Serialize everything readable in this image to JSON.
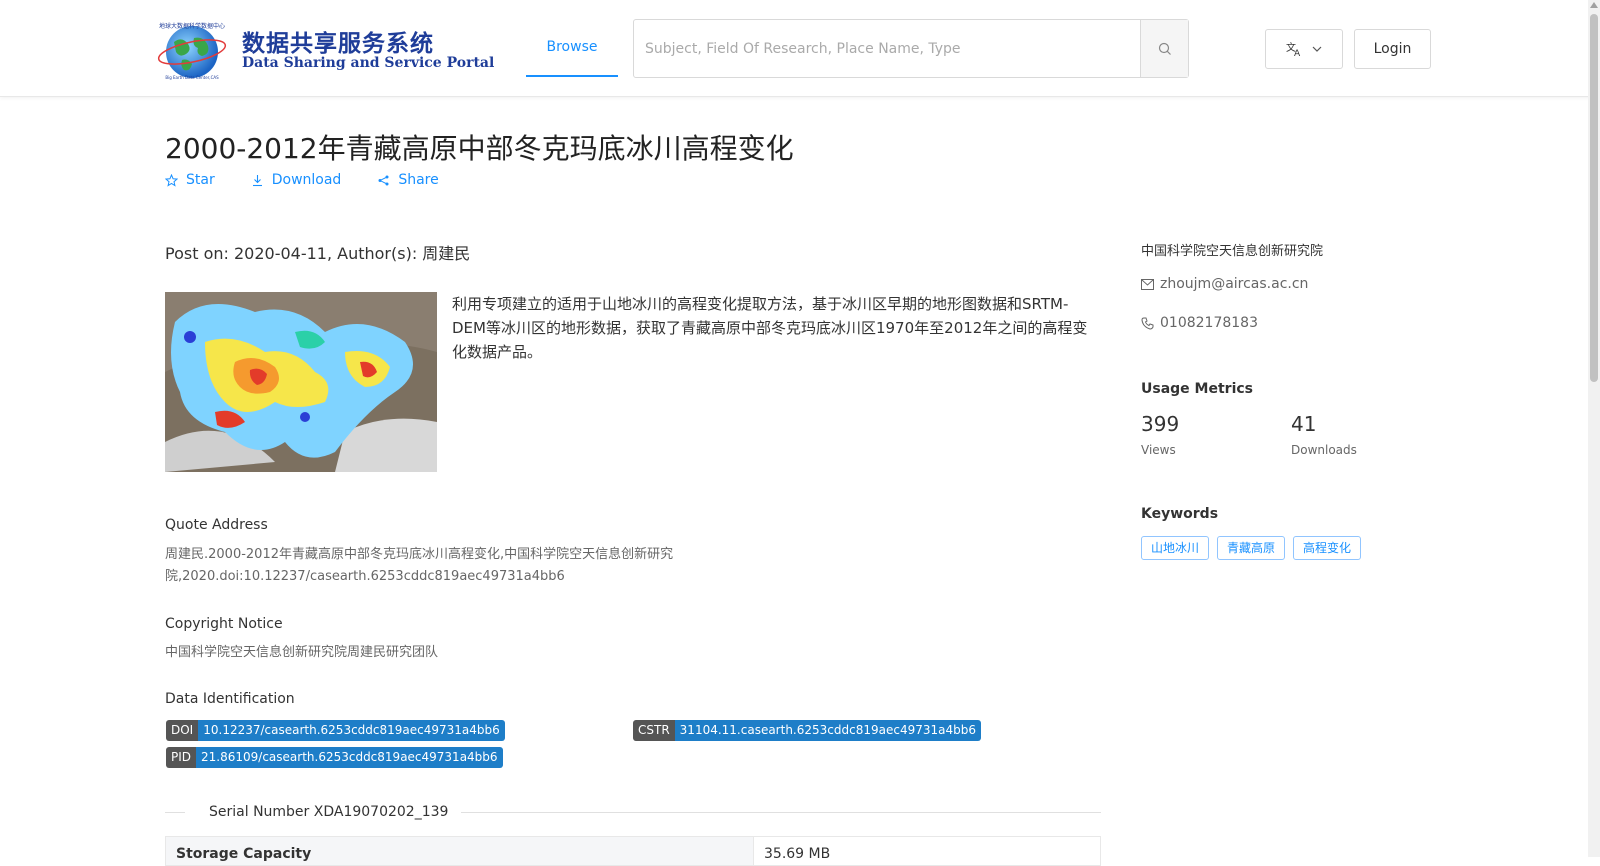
{
  "header": {
    "logo": {
      "cn": "数据共享服务系统",
      "en": "Data Sharing and Service Portal",
      "ring_text": "地球大数据科学数据中心",
      "ring_text_bottom": "Big Earth Data Center,CAS"
    },
    "nav_browse": "Browse",
    "search_placeholder": "Subject, Field Of Research, Place Name, Type",
    "login": "Login",
    "lang_icon": "translate-icon"
  },
  "dataset": {
    "title": "2000-2012年青藏高原中部冬克玛底冰川高程变化",
    "actions": {
      "star": "Star",
      "download": "Download",
      "share": "Share"
    },
    "post_on": "Post on: 2020-04-11, Author(s): 周建民",
    "description": "利用专项建立的适用于山地冰川的高程变化提取方法，基于冰川区早期的地形图数据和SRTM-DEM等冰川区的地形数据，获取了青藏高原中部冬克玛底冰川区1970年至2012年之间的高程变化数据产品。"
  },
  "sections": {
    "quote_label": "Quote Address",
    "quote_text": "周建民.2000-2012年青藏高原中部冬克玛底冰川高程变化,中国科学院空天信息创新研究院,2020.doi:10.12237/casearth.6253cddc819aec49731a4bb6",
    "copyright_label": "Copyright Notice",
    "copyright_text": "中国科学院空天信息创新研究院周建民研究团队",
    "identification_label": "Data Identification",
    "doi_key": "DOI",
    "doi_value": "10.12237/casearth.6253cddc819aec49731a4bb6",
    "cstr_key": "CSTR",
    "cstr_value": "31104.11.casearth.6253cddc819aec49731a4bb6",
    "pid_key": "PID",
    "pid_value": "21.86109/casearth.6253cddc819aec49731a4bb6",
    "serial": "Serial Number XDA19070202_139",
    "storage_label": "Storage Capacity",
    "storage_value": "35.69 MB"
  },
  "sidebar": {
    "org": "中国科学院空天信息创新研究院",
    "email": "zhoujm@aircas.ac.cn",
    "phone": "01082178183",
    "usage_title": "Usage Metrics",
    "views": "399",
    "views_label": "Views",
    "downloads": "41",
    "downloads_label": "Downloads",
    "keywords_title": "Keywords",
    "keywords": [
      "山地冰川",
      "青藏高原",
      "高程变化"
    ]
  },
  "colors": {
    "accent": "#1890ff",
    "badge_key": "#555555",
    "badge_value": "#1e7ec8",
    "logo_text": "#1f3d99"
  }
}
